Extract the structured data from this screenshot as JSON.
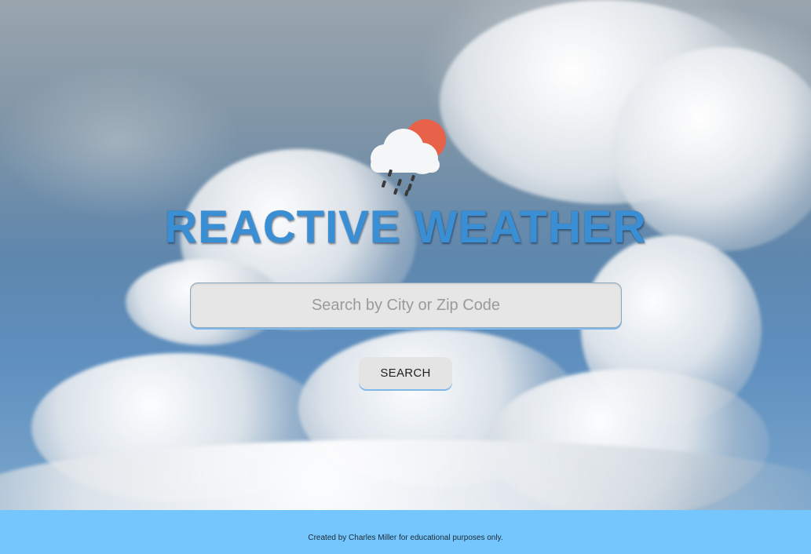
{
  "app": {
    "title": "REACTIVE WEATHER",
    "logo_icon": "cloud-rain-sun-icon"
  },
  "search": {
    "placeholder": "Search by City or Zip Code",
    "value": "",
    "button_label": "SEARCH"
  },
  "footer": {
    "text": "Created by Charles Miller for educational purposes only."
  },
  "colors": {
    "title": "#3a8fd4",
    "footer_bg": "#74c6fc",
    "sun": "#e8624a",
    "input_bg": "#e6e6e6"
  }
}
